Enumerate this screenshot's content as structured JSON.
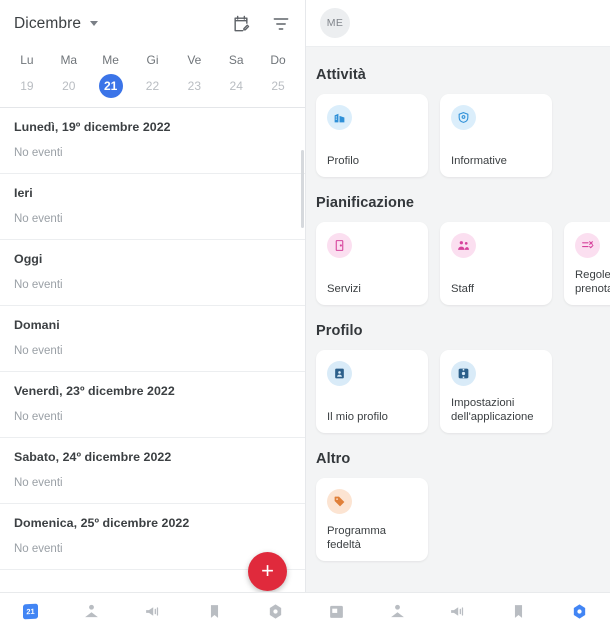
{
  "calendar": {
    "month": "Dicembre",
    "weekdays": [
      "Lu",
      "Ma",
      "Me",
      "Gi",
      "Ve",
      "Sa",
      "Do"
    ],
    "dates": [
      {
        "num": "19",
        "selected": false
      },
      {
        "num": "20",
        "selected": false
      },
      {
        "num": "21",
        "selected": true
      },
      {
        "num": "22",
        "selected": false
      },
      {
        "num": "23",
        "selected": false
      },
      {
        "num": "24",
        "selected": false
      },
      {
        "num": "25",
        "selected": false
      }
    ],
    "header_icons": [
      {
        "name": "calendar-edit-icon"
      },
      {
        "name": "filter-icon"
      }
    ],
    "fab_label": "+"
  },
  "agenda": {
    "days": [
      {
        "title": "Lunedì, 19º dicembre 2022",
        "events": "No eventi"
      },
      {
        "title": "Ieri",
        "events": "No eventi"
      },
      {
        "title": "Oggi",
        "events": "No eventi"
      },
      {
        "title": "Domani",
        "events": "No eventi"
      },
      {
        "title": "Venerdì, 23º dicembre 2022",
        "events": "No eventi"
      },
      {
        "title": "Sabato, 24º dicembre 2022",
        "events": "No eventi"
      },
      {
        "title": "Domenica, 25º dicembre 2022",
        "events": "No eventi"
      }
    ]
  },
  "settings": {
    "avatar_initials": "ME",
    "sections": [
      {
        "title": "Attività",
        "cards": [
          {
            "label": "Profilo",
            "icon": "building-icon",
            "theme": "ic-blue"
          },
          {
            "label": "Informative",
            "icon": "shield-icon",
            "theme": "ic-blue"
          }
        ]
      },
      {
        "title": "Pianificazione",
        "cards": [
          {
            "label": "Servizi",
            "icon": "door-icon",
            "theme": "ic-pink"
          },
          {
            "label": "Staff",
            "icon": "people-icon",
            "theme": "ic-pink"
          },
          {
            "label": "Regole di prenotazione",
            "icon": "checklist-icon",
            "theme": "ic-pink"
          }
        ]
      },
      {
        "title": "Profilo",
        "cards": [
          {
            "label": "Il mio profilo",
            "icon": "person-card-icon",
            "theme": "ic-navy"
          },
          {
            "label": "Impostazioni dell'applicazione",
            "icon": "settings-icon",
            "theme": "ic-navy"
          }
        ]
      },
      {
        "title": "Altro",
        "cards": [
          {
            "label": "Programma fedeltà",
            "icon": "tag-icon",
            "theme": "ic-orange"
          }
        ]
      }
    ]
  },
  "bottom_nav": {
    "left": [
      {
        "name": "calendar",
        "icon": "calendar-day-icon",
        "badge": "21",
        "active": true
      },
      {
        "name": "clients",
        "icon": "person-inbox-icon",
        "active": false
      },
      {
        "name": "marketing",
        "icon": "megaphone-icon",
        "active": false
      },
      {
        "name": "bookmarks",
        "icon": "bookmark-icon",
        "active": false
      },
      {
        "name": "settings",
        "icon": "gear-icon",
        "active": false
      }
    ],
    "right": [
      {
        "name": "calendar",
        "icon": "calendar-day-icon",
        "active": false
      },
      {
        "name": "clients",
        "icon": "person-inbox-icon",
        "active": false
      },
      {
        "name": "marketing",
        "icon": "megaphone-icon",
        "active": false
      },
      {
        "name": "bookmarks",
        "icon": "bookmark-icon",
        "active": false
      },
      {
        "name": "settings",
        "icon": "gear-icon",
        "active": true
      }
    ]
  },
  "colors": {
    "accent_blue": "#4285f4",
    "selected_date": "#3b74e8",
    "fab_red": "#e02a3c",
    "panel_bg": "#f3f4f5"
  }
}
